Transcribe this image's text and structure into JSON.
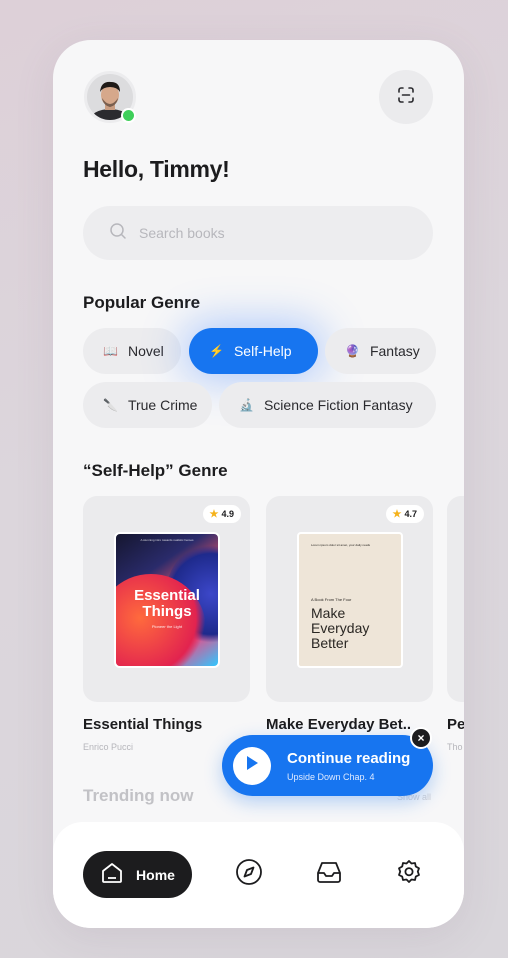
{
  "greeting": "Hello, Timmy!",
  "search": {
    "placeholder": "Search books"
  },
  "popular_genre": {
    "title": "Popular Genre",
    "chips": [
      {
        "label": "Novel",
        "emoji": "📖"
      },
      {
        "label": "Self-Help",
        "emoji": "⚡"
      },
      {
        "label": "Fantasy",
        "emoji": "🔮"
      },
      {
        "label": "True Crime",
        "emoji": "🔪"
      },
      {
        "label": "Science Fiction Fantasy",
        "emoji": "🔬"
      }
    ]
  },
  "genre_section": {
    "title": "“Self-Help” Genre",
    "books": [
      {
        "title": "Essential Things",
        "author": "Enrico Pucci",
        "rating": "4.9",
        "cover_title": "Essential Things",
        "cover_sub": "Pioneer the Light",
        "cover_top": "A stunning intro towards realistic heroes"
      },
      {
        "title": "Make Everyday Bet..",
        "author": "",
        "rating": "4.7",
        "cover_small": "Lorem ipsum dolor sit amet, your daily reads",
        "cover_label": "A Book From The Four",
        "cover_big": "Make Everyday Better"
      },
      {
        "title": "Pe",
        "author": "Tho"
      }
    ]
  },
  "trending": {
    "title": "Trending now",
    "show_all": "Show all"
  },
  "continue_reading": {
    "title": "Continue reading",
    "subtitle": "Upside Down Chap. 4",
    "close": "×"
  },
  "nav": {
    "home_label": "Home"
  },
  "colors": {
    "accent": "#1775f0",
    "online": "#3fcf5a",
    "dark": "#1c1c1e"
  }
}
